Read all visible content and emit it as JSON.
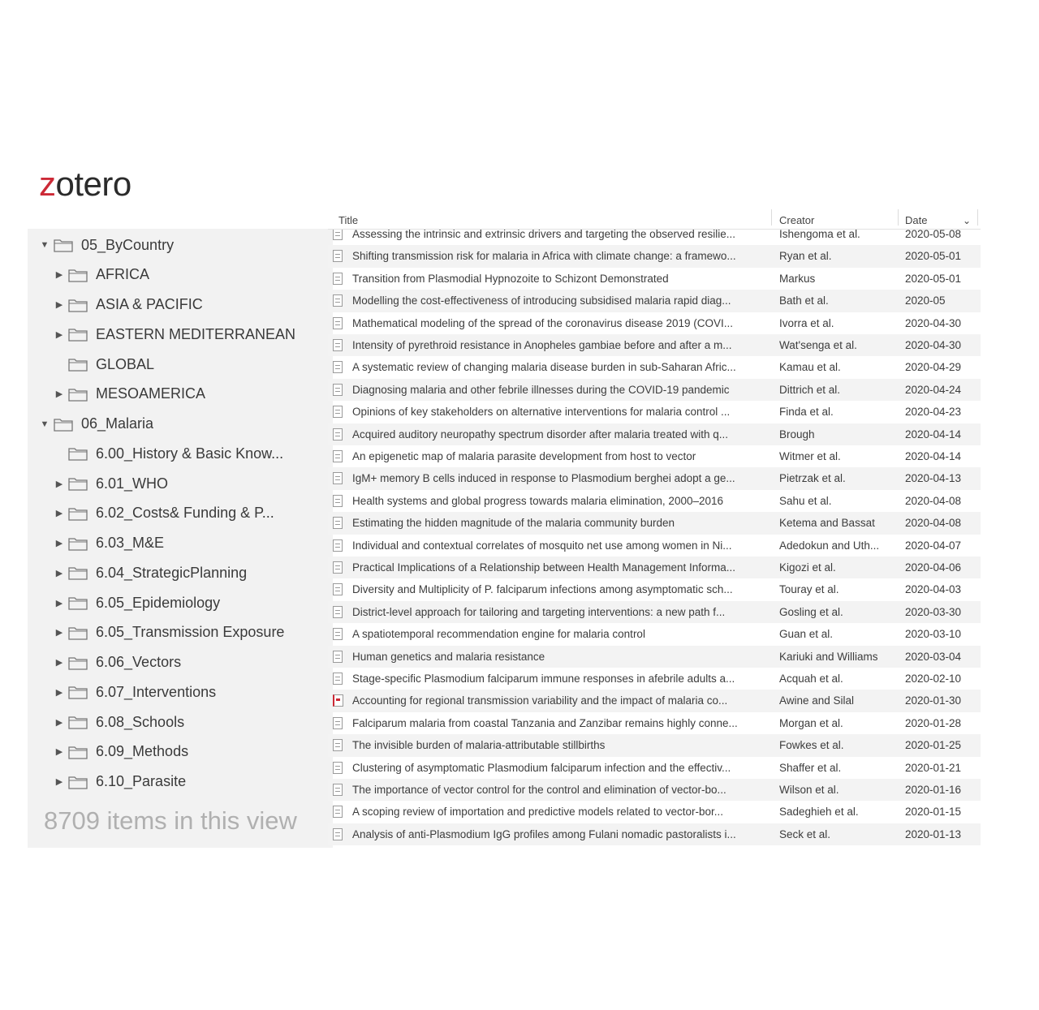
{
  "app": {
    "logo_prefix": "z",
    "logo_rest": "otero",
    "accent_color": "#cc2936"
  },
  "sidebar": {
    "items": [
      {
        "label": "05_ByCountry",
        "twisty": "▼",
        "icon": "folder-icon"
      },
      {
        "label": "AFRICA",
        "twisty": "▶",
        "icon": "folder-icon"
      },
      {
        "label": "ASIA & PACIFIC",
        "twisty": "▶",
        "icon": "folder-icon"
      },
      {
        "label": "EASTERN MEDITERRANEAN",
        "twisty": "▶",
        "icon": "folder-icon"
      },
      {
        "label": "GLOBAL",
        "twisty": "",
        "icon": "folder-icon"
      },
      {
        "label": "MESOAMERICA",
        "twisty": "▶",
        "icon": "folder-icon"
      },
      {
        "label": "06_Malaria",
        "twisty": "▼",
        "icon": "folder-icon"
      },
      {
        "label": "6.00_History & Basic Know...",
        "twisty": "",
        "icon": "folder-icon"
      },
      {
        "label": "6.01_WHO",
        "twisty": "▶",
        "icon": "folder-icon"
      },
      {
        "label": "6.02_Costs& Funding & P...",
        "twisty": "▶",
        "icon": "folder-icon"
      },
      {
        "label": "6.03_M&E",
        "twisty": "▶",
        "icon": "folder-icon"
      },
      {
        "label": "6.04_StrategicPlanning",
        "twisty": "▶",
        "icon": "folder-icon"
      },
      {
        "label": "6.05_Epidemiology",
        "twisty": "▶",
        "icon": "folder-icon"
      },
      {
        "label": "6.05_Transmission Exposure",
        "twisty": "▶",
        "icon": "folder-icon"
      },
      {
        "label": "6.06_Vectors",
        "twisty": "▶",
        "icon": "folder-icon"
      },
      {
        "label": "6.07_Interventions",
        "twisty": "▶",
        "icon": "folder-icon"
      },
      {
        "label": "6.08_Schools",
        "twisty": "▶",
        "icon": "folder-icon"
      },
      {
        "label": "6.09_Methods",
        "twisty": "▶",
        "icon": "folder-icon"
      },
      {
        "label": "6.10_Parasite",
        "twisty": "▶",
        "icon": "folder-icon"
      }
    ],
    "items_count": "8709 items in this view"
  },
  "table": {
    "columns": {
      "title": "Title",
      "creator": "Creator",
      "date": "Date",
      "sort_indicator": "⌄"
    },
    "rows": [
      {
        "type": "doc",
        "title": "Assessing the intrinsic and extrinsic drivers and targeting the observed resilie...",
        "creator": "Ishengoma et al.",
        "date": "2020-05-08"
      },
      {
        "type": "doc",
        "title": "Shifting transmission risk for malaria in Africa with climate change: a framewo...",
        "creator": "Ryan et al.",
        "date": "2020-05-01"
      },
      {
        "type": "doc",
        "title": "Transition from Plasmodial Hypnozoite to Schizont Demonstrated",
        "creator": "Markus",
        "date": "2020-05-01"
      },
      {
        "type": "doc",
        "title": "Modelling the cost-effectiveness of introducing subsidised malaria rapid diag...",
        "creator": "Bath et al.",
        "date": "2020-05"
      },
      {
        "type": "doc",
        "title": "Mathematical modeling of the spread of the coronavirus disease 2019 (COVI...",
        "creator": "Ivorra et al.",
        "date": "2020-04-30"
      },
      {
        "type": "doc",
        "title": "Intensity of pyrethroid resistance in Anopheles gambiae before and after a m...",
        "creator": "Wat'senga et al.",
        "date": "2020-04-30"
      },
      {
        "type": "doc",
        "title": "A systematic review of changing malaria disease burden in sub-Saharan Afric...",
        "creator": "Kamau et al.",
        "date": "2020-04-29"
      },
      {
        "type": "doc",
        "title": "Diagnosing malaria and other febrile illnesses during the COVID-19 pandemic",
        "creator": "Dittrich et al.",
        "date": "2020-04-24"
      },
      {
        "type": "doc",
        "title": "Opinions of key stakeholders on alternative interventions for malaria control ...",
        "creator": "Finda et al.",
        "date": "2020-04-23"
      },
      {
        "type": "doc",
        "title": "Acquired auditory neuropathy spectrum disorder after malaria treated with q...",
        "creator": "Brough",
        "date": "2020-04-14"
      },
      {
        "type": "doc",
        "title": "An epigenetic map of malaria parasite development from host to vector",
        "creator": "Witmer et al.",
        "date": "2020-04-14"
      },
      {
        "type": "doc",
        "title": "IgM+ memory B cells induced in response to Plasmodium berghei adopt a ge...",
        "creator": "Pietrzak et al.",
        "date": "2020-04-13"
      },
      {
        "type": "doc",
        "title": "Health systems and global progress towards malaria elimination, 2000–2016",
        "creator": "Sahu et al.",
        "date": "2020-04-08"
      },
      {
        "type": "doc",
        "title": "Estimating the hidden magnitude of the malaria community burden",
        "creator": "Ketema and Bassat",
        "date": "2020-04-08"
      },
      {
        "type": "doc",
        "title": "Individual and contextual correlates of mosquito net use among women in Ni...",
        "creator": "Adedokun and Uth...",
        "date": "2020-04-07"
      },
      {
        "type": "doc",
        "title": "Practical Implications of a Relationship between Health Management Informa...",
        "creator": "Kigozi et al.",
        "date": "2020-04-06"
      },
      {
        "type": "doc",
        "title": "Diversity and Multiplicity of P. falciparum infections among asymptomatic sch...",
        "creator": "Touray et al.",
        "date": "2020-04-03"
      },
      {
        "type": "doc",
        "title": "District-level approach for tailoring and targeting interventions: a new path f...",
        "creator": "Gosling et al.",
        "date": "2020-03-30"
      },
      {
        "type": "doc",
        "title": "A spatiotemporal recommendation engine for malaria control",
        "creator": "Guan et al.",
        "date": "2020-03-10"
      },
      {
        "type": "doc",
        "title": "Human genetics and malaria resistance",
        "creator": "Kariuki and Williams",
        "date": "2020-03-04"
      },
      {
        "type": "doc",
        "title": "Stage-specific Plasmodium falciparum immune responses in afebrile adults a...",
        "creator": "Acquah et al.",
        "date": "2020-02-10"
      },
      {
        "type": "pdf",
        "title": "Accounting for regional transmission variability and the impact of malaria co...",
        "creator": "Awine and Silal",
        "date": "2020-01-30"
      },
      {
        "type": "doc",
        "title": "Falciparum malaria from coastal Tanzania and Zanzibar remains highly conne...",
        "creator": "Morgan et al.",
        "date": "2020-01-28"
      },
      {
        "type": "doc",
        "title": "The invisible burden of malaria-attributable stillbirths",
        "creator": "Fowkes et al.",
        "date": "2020-01-25"
      },
      {
        "type": "doc",
        "title": "Clustering of asymptomatic Plasmodium falciparum infection and the effectiv...",
        "creator": "Shaffer et al.",
        "date": "2020-01-21"
      },
      {
        "type": "doc",
        "title": "The importance of vector control for the control and elimination of vector-bo...",
        "creator": "Wilson et al.",
        "date": "2020-01-16"
      },
      {
        "type": "doc",
        "title": "A scoping review of importation and predictive models related to vector-bor...",
        "creator": "Sadeghieh et al.",
        "date": "2020-01-15"
      },
      {
        "type": "doc",
        "title": "Analysis of anti-Plasmodium IgG profiles among Fulani nomadic pastoralists i...",
        "creator": "Seck et al.",
        "date": "2020-01-13"
      }
    ]
  }
}
